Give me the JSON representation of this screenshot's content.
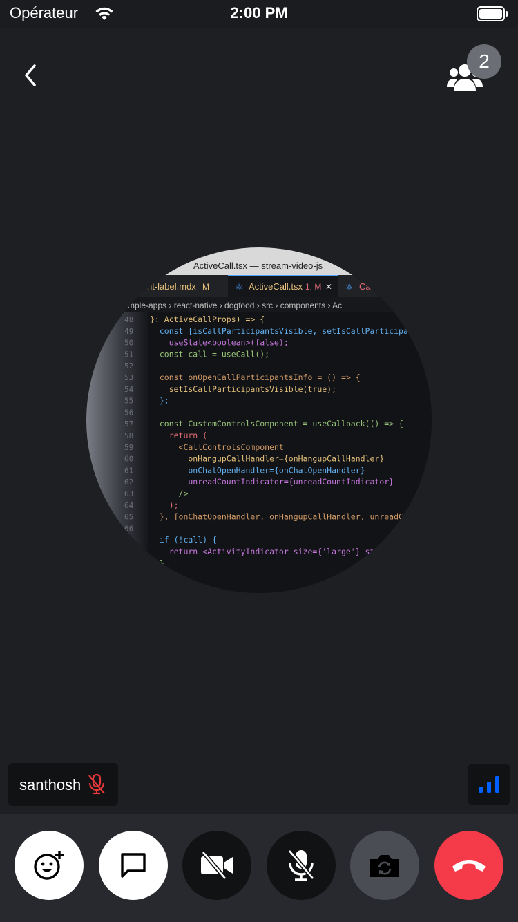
{
  "status_bar": {
    "carrier": "Opérateur",
    "time": "2:00 PM"
  },
  "header": {
    "participant_count": "2"
  },
  "screen_share": {
    "window_title": "ActiveCall.tsx — stream-video-js",
    "tabs": [
      {
        "label": "nt-label.mdx",
        "badge": "M"
      },
      {
        "label": "ActiveCall.tsx",
        "badge": "1, M",
        "close": "✕"
      },
      {
        "label": "Ca",
        "badge": ""
      }
    ],
    "breadcrumb": "mple-apps › react-native › dogfood › src › components › Ac",
    "code_lines": [
      {
        "n": "48",
        "text": "}: ActiveCallProps) => {"
      },
      {
        "n": "49",
        "text": "  const [isCallParticipantsVisible, setIsCallParticipan"
      },
      {
        "n": "50",
        "text": "    useState<boolean>(false);"
      },
      {
        "n": "51",
        "text": "  const call = useCall();"
      },
      {
        "n": "52",
        "text": ""
      },
      {
        "n": "53",
        "text": "  const onOpenCallParticipantsInfo = () => {"
      },
      {
        "n": "54",
        "text": "    setIsCallParticipantsVisible(true);"
      },
      {
        "n": "55",
        "text": "  };"
      },
      {
        "n": "56",
        "text": ""
      },
      {
        "n": "57",
        "text": "  const CustomControlsComponent = useCallback(() => {"
      },
      {
        "n": "58",
        "text": "    return ("
      },
      {
        "n": "59",
        "text": "      <CallControlsComponent"
      },
      {
        "n": "60",
        "text": "        onHangupCallHandler={onHangupCallHandler}"
      },
      {
        "n": "61",
        "text": "        onChatOpenHandler={onChatOpenHandler}"
      },
      {
        "n": "62",
        "text": "        unreadCountIndicator={unreadCountIndicator}"
      },
      {
        "n": "63",
        "text": "      />"
      },
      {
        "n": "64",
        "text": "    );"
      },
      {
        "n": "65",
        "text": "  }, [onChatOpenHandler, onHangupCallHandler, unreadCo"
      },
      {
        "n": "66",
        "text": ""
      },
      {
        "n": "",
        "text": "  if (!call) {"
      },
      {
        "n": "",
        "text": "    return <ActivityIndicator size={'large'} st"
      },
      {
        "n": "",
        "text": "  }"
      }
    ]
  },
  "participant": {
    "name": "santhosh"
  },
  "controls": {
    "reaction_icon": "emoji-plus-icon",
    "chat_icon": "chat-bubble-icon",
    "video_icon": "video-off-icon",
    "mic_icon": "mic-off-icon",
    "flip_icon": "camera-flip-icon",
    "hangup_icon": "phone-hangup-icon"
  },
  "colors": {
    "background": "#1e1f22",
    "controls_bar": "#27292e",
    "hangup_red": "#f53a4a",
    "mute_red": "#e5383b",
    "signal_blue": "#005fff",
    "badge_grey": "#6b6e74"
  }
}
